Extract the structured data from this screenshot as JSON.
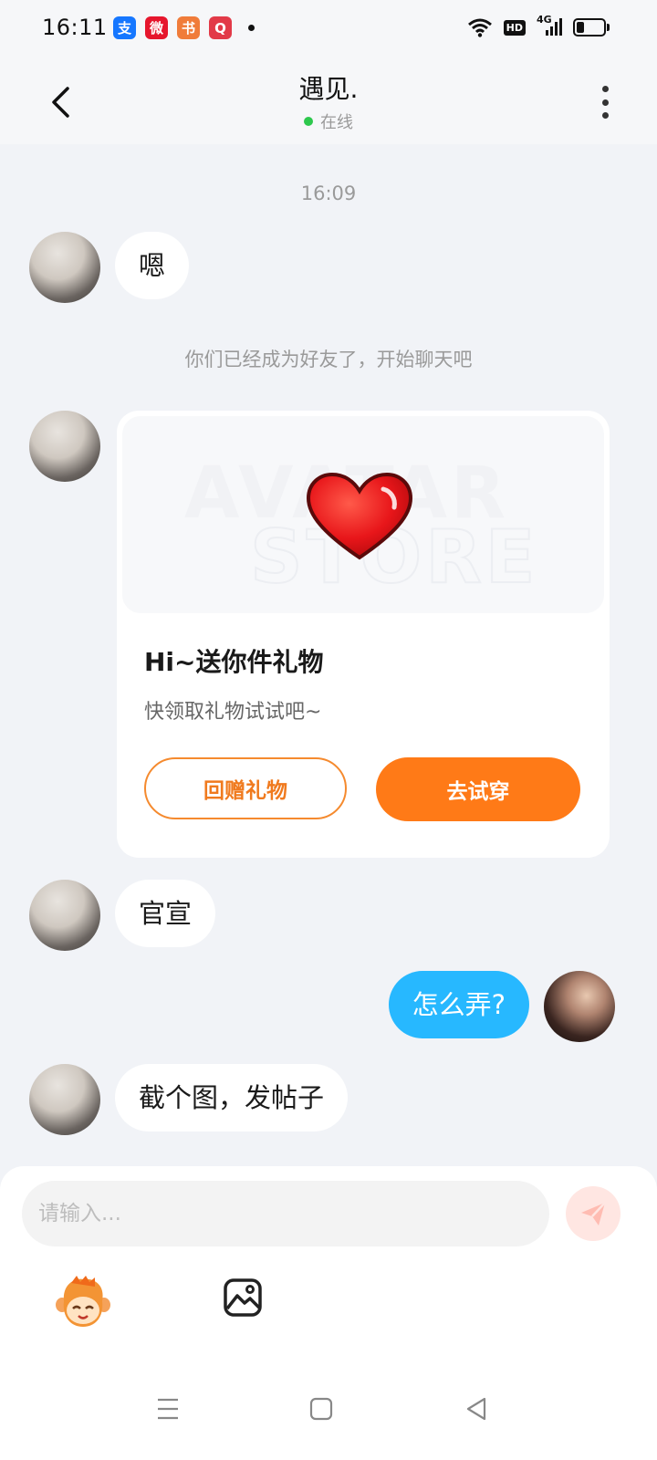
{
  "status_bar": {
    "time": "16:11",
    "apps": [
      {
        "name": "alipay-icon",
        "glyph": "支",
        "color": "#1677ff"
      },
      {
        "name": "weibo-icon",
        "glyph": "微",
        "color": "#e6162d"
      },
      {
        "name": "reader-icon",
        "glyph": "书",
        "color": "#f07c3a"
      },
      {
        "name": "video-app-icon",
        "glyph": "Q",
        "color": "#e23a48"
      }
    ],
    "hd": "HD",
    "network": "4G",
    "battery_level": 0.3
  },
  "header": {
    "title": "遇见.",
    "status": "在线"
  },
  "messages": {
    "time_separator": "16:09",
    "msg1": "嗯",
    "system_note": "你们已经成为好友了，开始聊天吧",
    "gift_card": {
      "watermark_line1": "AVATAR",
      "watermark_line2": "STORE",
      "title": "Hi~送你件礼物",
      "subtitle": "快领取礼物试试吧~",
      "return_gift_label": "回赠礼物",
      "try_on_label": "去试穿"
    },
    "msg2": "官宣",
    "msg_me": "怎么弄?",
    "msg3": "截个图，发帖子"
  },
  "input": {
    "placeholder": "请输入..."
  },
  "colors": {
    "accent_orange": "#ff7a17",
    "my_bubble": "#27b8ff",
    "online_green": "#2dc84d"
  }
}
